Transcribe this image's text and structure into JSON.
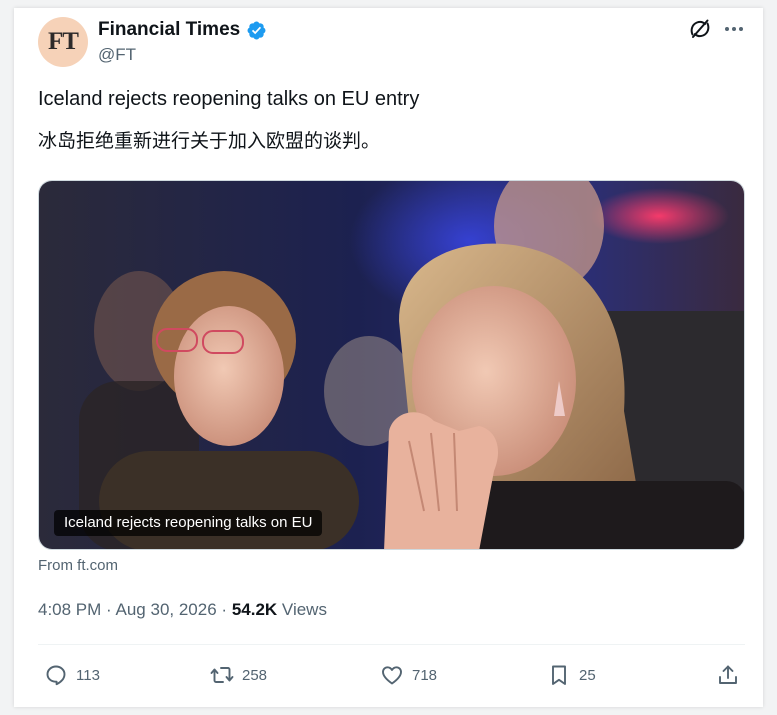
{
  "author": {
    "avatar_text": "FT",
    "display_name": "Financial Times",
    "handle": "@FT",
    "verified": true
  },
  "tweet": {
    "text_en": "Iceland rejects reopening talks on EU entry",
    "text_zh": "冰岛拒绝重新进行关于加入欧盟的谈判。"
  },
  "media": {
    "caption": "Iceland rejects reopening talks on EU",
    "source": "From ft.com"
  },
  "meta": {
    "time": "4:08 PM",
    "separator": "·",
    "date": "Aug 30, 2026",
    "views_count": "54.2K",
    "views_label": "Views"
  },
  "actions": {
    "reply_count": "113",
    "retweet_count": "258",
    "like_count": "718",
    "bookmark_count": "25"
  },
  "colors": {
    "verified_blue": "#1d9bf0",
    "text_primary": "#0f1419",
    "text_secondary": "#536471"
  },
  "icons": [
    "verified-badge-icon",
    "grok-icon",
    "more-icon",
    "reply-icon",
    "retweet-icon",
    "like-icon",
    "bookmark-icon",
    "share-icon"
  ]
}
